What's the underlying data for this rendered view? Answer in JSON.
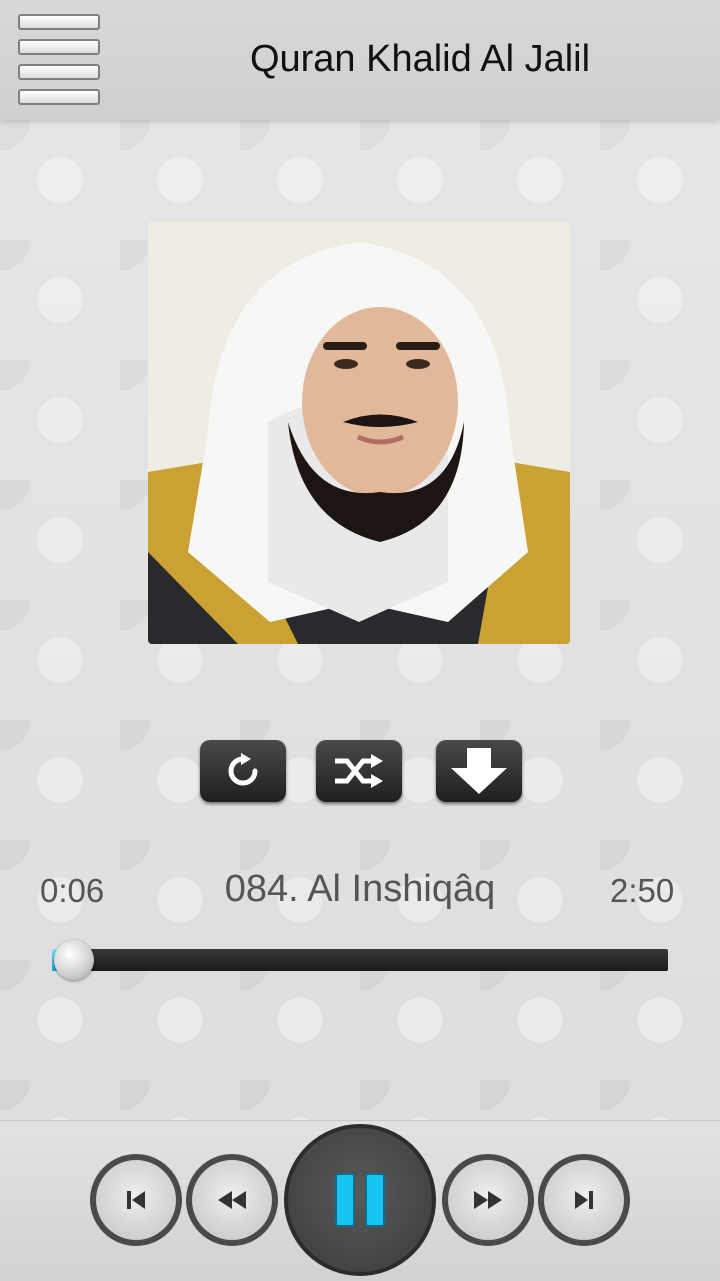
{
  "header": {
    "title": "Quran Khalid Al Jalil",
    "menu_icon": "menu-icon"
  },
  "controls": [
    {
      "name": "repeat-button",
      "icon": "repeat-icon"
    },
    {
      "name": "shuffle-button",
      "icon": "shuffle-icon"
    },
    {
      "name": "download-button",
      "icon": "download-icon"
    }
  ],
  "player": {
    "elapsed": "0:06",
    "track": "084. Al Inshiqâq",
    "duration": "2:50",
    "progress_fraction": 0.035
  },
  "transport": [
    {
      "name": "previous-track-button",
      "icon": "skip-previous-icon"
    },
    {
      "name": "rewind-button",
      "icon": "rewind-icon"
    },
    {
      "name": "pause-button",
      "icon": "pause-icon"
    },
    {
      "name": "fast-forward-button",
      "icon": "fast-forward-icon"
    },
    {
      "name": "next-track-button",
      "icon": "skip-next-icon"
    }
  ],
  "colors": {
    "accent": "#19c3f0",
    "bar_dark": "#2a2a2a"
  }
}
